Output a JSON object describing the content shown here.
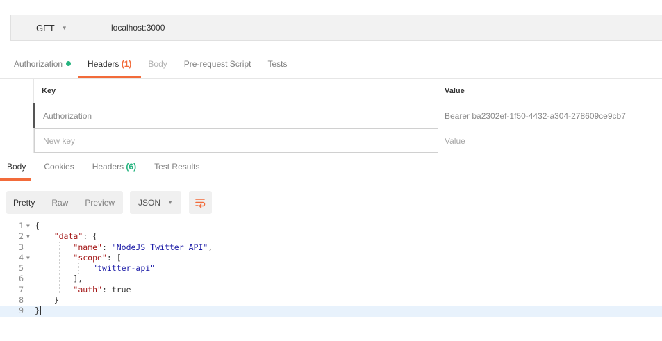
{
  "request": {
    "method": "GET",
    "url": "localhost:3000"
  },
  "request_tabs": [
    {
      "label": "Authorization",
      "state": "normal",
      "indicator": "dot"
    },
    {
      "label": "Headers",
      "count": "(1)",
      "state": "active"
    },
    {
      "label": "Body",
      "state": "disabled"
    },
    {
      "label": "Pre-request Script",
      "state": "normal"
    },
    {
      "label": "Tests",
      "state": "normal"
    }
  ],
  "headers_table": {
    "columns": {
      "key": "Key",
      "value": "Value"
    },
    "rows": [
      {
        "key": "Authorization",
        "value": "Bearer ba2302ef-1f50-4432-a304-278609ce9cb7"
      }
    ],
    "new_row": {
      "key_placeholder": "New key",
      "value_placeholder": "Value"
    }
  },
  "response_tabs": [
    {
      "label": "Body",
      "state": "active"
    },
    {
      "label": "Cookies",
      "state": "normal"
    },
    {
      "label": "Headers",
      "count": "(6)",
      "state": "normal"
    },
    {
      "label": "Test Results",
      "state": "normal"
    }
  ],
  "toolbar": {
    "formats": [
      "Pretty",
      "Raw",
      "Preview"
    ],
    "active_format": "Pretty",
    "language": "JSON",
    "wrap_icon": "wrap-lines-icon"
  },
  "response_body": {
    "lines": [
      {
        "n": "1",
        "fold": true
      },
      {
        "n": "2",
        "fold": true
      },
      {
        "n": "3",
        "fold": false
      },
      {
        "n": "4",
        "fold": true
      },
      {
        "n": "5",
        "fold": false
      },
      {
        "n": "6",
        "fold": false
      },
      {
        "n": "7",
        "fold": false
      },
      {
        "n": "8",
        "fold": false
      },
      {
        "n": "9",
        "fold": false
      }
    ],
    "tokens": {
      "open": "{",
      "data_key": "\"data\"",
      "name_key": "\"name\"",
      "name_val": "\"NodeJS Twitter API\"",
      "scope_key": "\"scope\"",
      "scope_item": "\"twitter-api\"",
      "auth_key": "\"auth\"",
      "auth_val": "true",
      "close": "}"
    }
  },
  "colors": {
    "accent": "#f26b3a",
    "success": "#26b47f",
    "json_key": "#a31515",
    "json_string": "#1a1aa6",
    "highlight_line": "#e8f2fc"
  }
}
